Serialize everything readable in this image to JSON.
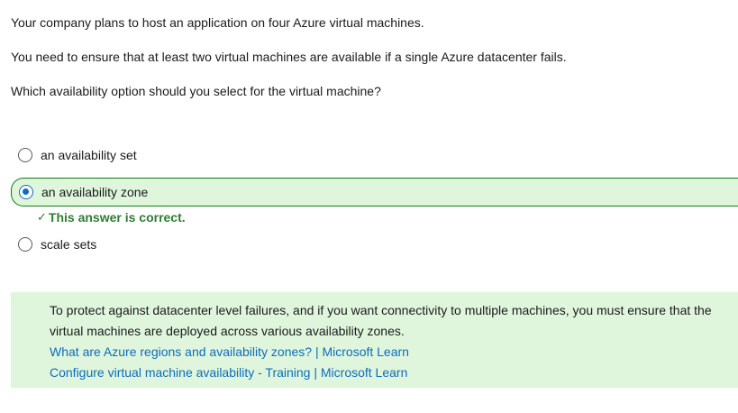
{
  "question": {
    "line1": "Your company plans to host an application on four Azure virtual machines.",
    "line2": "You need to ensure that at least two virtual machines are available if a single Azure datacenter fails.",
    "line3": "Which availability option should you select for the virtual machine?"
  },
  "options": [
    {
      "label": "an availability set",
      "selected": false
    },
    {
      "label": "an availability zone",
      "selected": true
    },
    {
      "label": "scale sets",
      "selected": false
    }
  ],
  "feedback": {
    "icon": "checkmark-icon",
    "text": "This answer is correct."
  },
  "explanation": {
    "text": "To protect against datacenter level failures, and if you want connectivity to multiple machines, you must ensure that the virtual machines are deployed across various availability zones.",
    "links": [
      "What are Azure regions and availability zones? | Microsoft Learn",
      "Configure virtual machine availability - Training | Microsoft Learn"
    ]
  },
  "colors": {
    "correct_bg": "#dff6dd",
    "correct_border": "#107c10",
    "link": "#0f6cbd",
    "radio_selected": "#0f6cbd"
  }
}
